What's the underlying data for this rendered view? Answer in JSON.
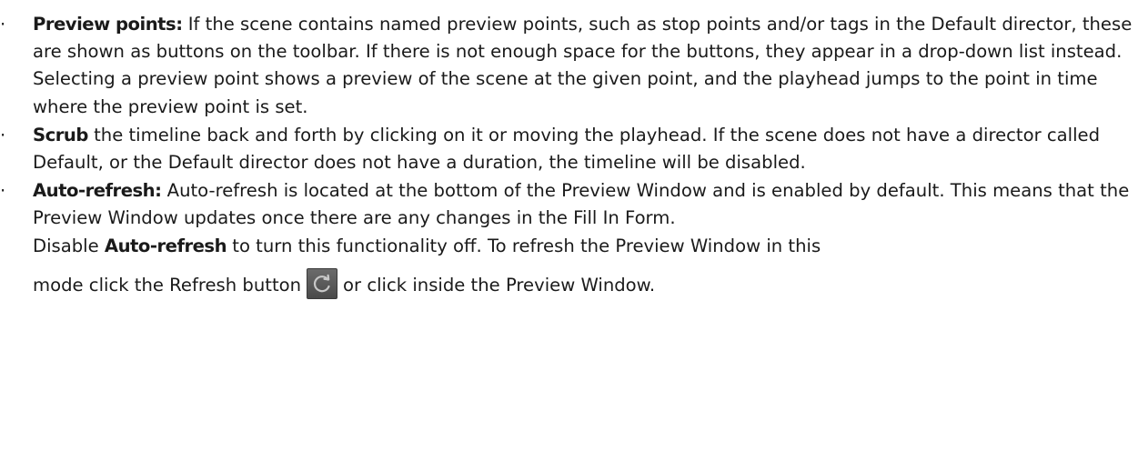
{
  "bullet_symbol": "·",
  "items": [
    {
      "term": "Preview points:",
      "text": " If the scene contains named preview points, such as stop points and/or tags in the Default director, these are shown as buttons on the toolbar. If there is not enough space for the buttons, they appear in a drop-down list instead. Selecting a preview point shows a preview of the scene at the given point, and the playhead jumps to the point in time where the preview point is set."
    },
    {
      "term": "Scrub",
      "text": " the timeline back and forth by clicking on it or moving the playhead. If the scene does not have a director called Default, or the Default director does not have a duration, the timeline will be disabled."
    },
    {
      "term": "Auto-refresh:",
      "text": " Auto-refresh is located at the bottom of the Preview Window and is enabled by default. This means that the Preview Window updates once there are any changes in the Fill In Form.",
      "cont_pre": "Disable ",
      "cont_term": "Auto-refresh",
      "cont_text": " to turn this functionality off. To refresh the Preview Window in this",
      "last_pre": "mode click the Refresh button",
      "last_post": "or click inside the Preview Window.",
      "refresh_icon": "refresh-icon"
    }
  ]
}
